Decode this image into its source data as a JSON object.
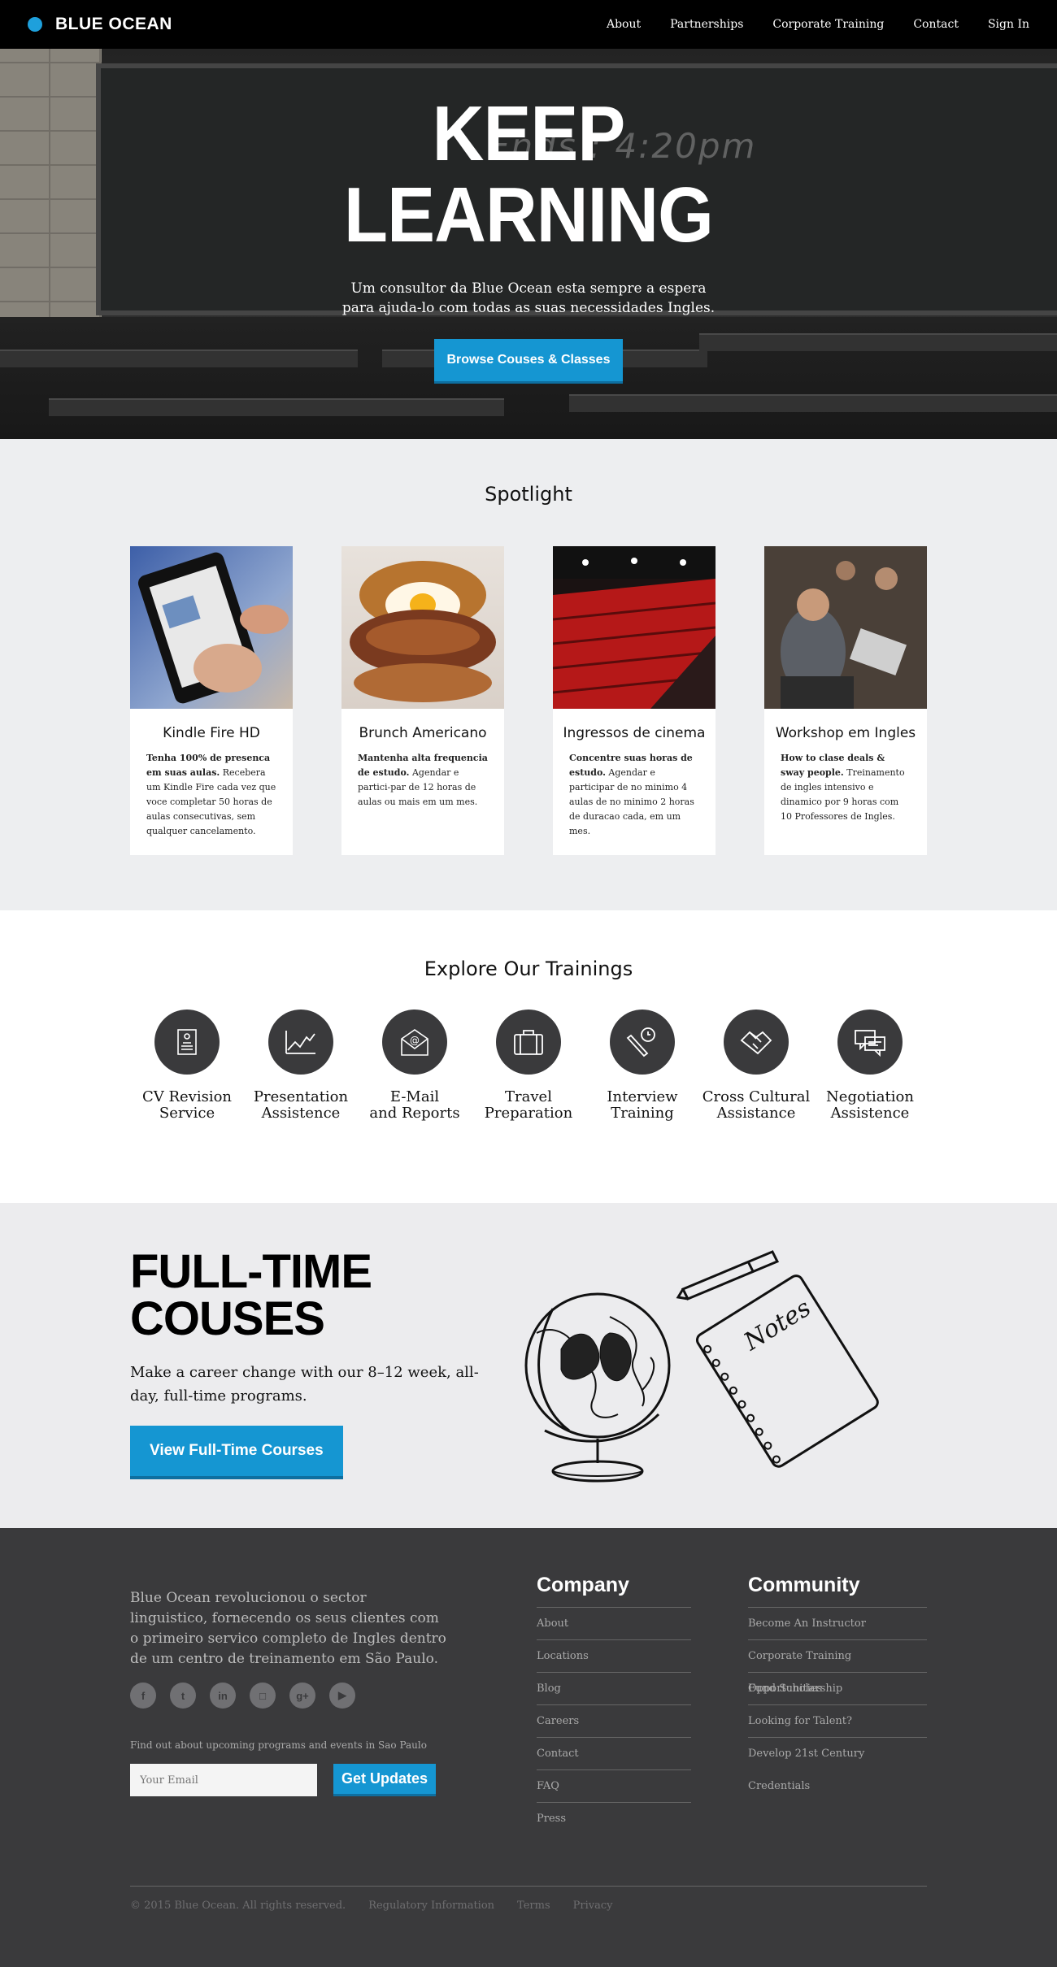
{
  "nav": {
    "brand": "BLUE OCEAN",
    "links": [
      "About",
      "Partnerships",
      "Corporate Training",
      "Contact",
      "Sign In"
    ]
  },
  "hero": {
    "title_line1": "KEEP",
    "title_line2": "LEARNING",
    "chalk_text": "Ends : 4:20pm",
    "subtitle_line1": "Um consultor da Blue Ocean esta sempre a espera",
    "subtitle_line2": "para ajuda-lo com todas as suas necessidades Ingles.",
    "button": "Browse Couses & Classes"
  },
  "spotlight": {
    "title": "Spotlight",
    "cards": [
      {
        "title": "Kindle Fire HD",
        "bold": "Tenha 100% de presenca em suas aulas.",
        "text": " Recebera um Kindle Fire cada vez que voce completar 50 horas de aulas consecutivas, sem qualquer cancelamento."
      },
      {
        "title": "Brunch Americano",
        "bold": "Mantenha alta frequencia de estudo.",
        "text": " Agendar e partici-par de 12 horas de aulas ou mais em um mes."
      },
      {
        "title": "Ingressos de cinema",
        "bold": "Concentre suas horas de estudo.",
        "text": " Agendar e participar de no minimo 4 aulas de no minimo 2 horas de duracao cada, em um mes."
      },
      {
        "title": "Workshop em Ingles",
        "bold": "How to clase deals & sway people.",
        "text": " Treinamento de ingles intensivo e dinamico por 9 horas com 10 Professores de Ingles."
      }
    ]
  },
  "trainings": {
    "title": "Explore Our Trainings",
    "items": [
      {
        "line1": "CV Revision",
        "line2": "Service",
        "icon": "document-icon"
      },
      {
        "line1": "Presentation",
        "line2": "Assistence",
        "icon": "chart-icon"
      },
      {
        "line1": "E-Mail",
        "line2": "and Reports",
        "icon": "email-icon"
      },
      {
        "line1": "Travel",
        "line2": "Preparation",
        "icon": "briefcase-icon"
      },
      {
        "line1": "Interview",
        "line2": "Training",
        "icon": "interview-icon"
      },
      {
        "line1": "Cross Cultural",
        "line2": "Assistance",
        "icon": "handshake-icon"
      },
      {
        "line1": "Negotiation",
        "line2": "Assistence",
        "icon": "chat-icon"
      }
    ]
  },
  "fulltime": {
    "title_line1": "FULL-TIME",
    "title_line2": "COUSES",
    "text": "Make a career change with our 8–12 week, all-day, full-time programs.",
    "button": "View Full-Time Courses",
    "notebook_label": "Notes"
  },
  "footer": {
    "about": "Blue Ocean revolucionou o sector linguistico, fornecendo os seus clientes com o primeiro servico completo de Ingles dentro de um centro de treinamento em São Paulo.",
    "socials": [
      "facebook-icon",
      "twitter-icon",
      "linkedin-icon",
      "instagram-icon",
      "googleplus-icon",
      "youtube-icon"
    ],
    "newsletter": "Find out about upcoming programs and events in Sao Paulo",
    "email_placeholder": "Your Email",
    "email_button": "Get Updates",
    "company": {
      "title": "Company",
      "links": [
        "About",
        "Locations",
        "Blog",
        "Careers",
        "Contact",
        "FAQ",
        "Press"
      ]
    },
    "community": {
      "title": "Community",
      "links": [
        "Become An Instructor",
        "Corporate Training Opportunities",
        "Fund Scholarship",
        "Looking for Talent?",
        "Develop 21st Century Credentials"
      ]
    },
    "copyright": "© 2015 Blue Ocean. All rights reserved.",
    "legal": [
      "Regulatory Information",
      "Terms",
      "Privacy"
    ]
  },
  "colors": {
    "accent": "#1596d2",
    "dark": "#3a3a3c",
    "light": "#edeef0"
  }
}
